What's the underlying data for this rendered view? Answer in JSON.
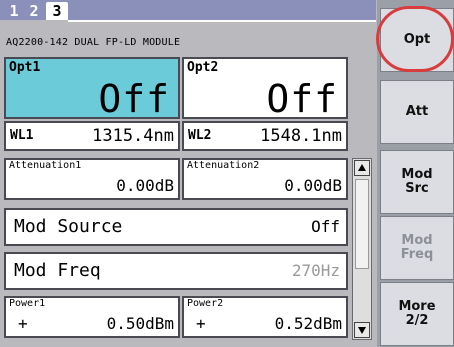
{
  "tabs": {
    "t1": "1",
    "t2": "2",
    "t3": "3"
  },
  "header": "AQ2200-142 DUAL FP-LD MODULE",
  "opt1": {
    "label": "Opt1",
    "value": "Off"
  },
  "opt2": {
    "label": "Opt2",
    "value": "Off"
  },
  "wl1": {
    "label": "WL1",
    "value": "1315.4nm"
  },
  "wl2": {
    "label": "WL2",
    "value": "1548.1nm"
  },
  "att1": {
    "label": "Attenuation1",
    "value": "0.00dB"
  },
  "att2": {
    "label": "Attenuation2",
    "value": "0.00dB"
  },
  "mod_source": {
    "label": "Mod Source",
    "value": "Off"
  },
  "mod_freq": {
    "label": "Mod Freq",
    "value": "270Hz"
  },
  "power1": {
    "label": "Power1",
    "sign": "+",
    "value": "0.50dBm"
  },
  "power2": {
    "label": "Power2",
    "sign": "+",
    "value": "0.52dBm"
  },
  "softkeys": {
    "opt": "Opt",
    "att": "Att",
    "mod_src": "Mod\nSrc",
    "mod_freq": "Mod\nFreq",
    "more": "More\n2/2"
  },
  "colors": {
    "opt1_active": "#6ccbd8",
    "highlight_circle": "#d83c3c"
  },
  "icons": {
    "scroll_up": "triangle-up-icon",
    "scroll_down": "triangle-down-icon"
  }
}
